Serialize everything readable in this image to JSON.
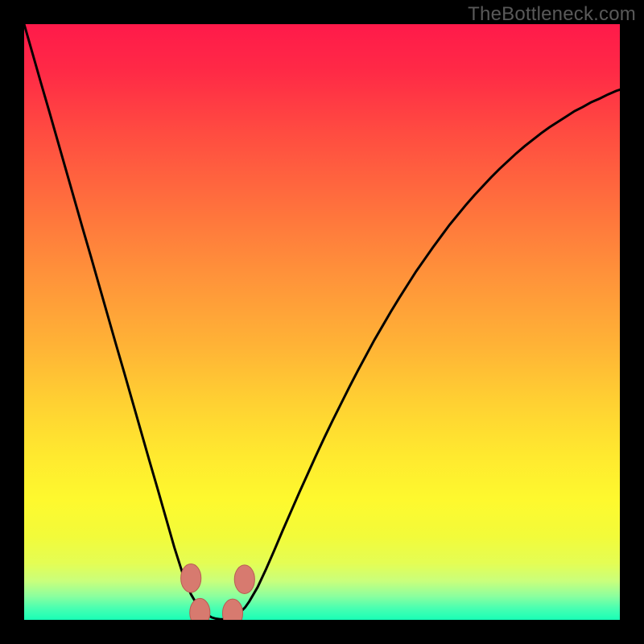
{
  "watermark": {
    "text": "TheBottleneck.com"
  },
  "colors": {
    "black": "#000000",
    "curve": "#000000",
    "dot_fill": "#d77a6f",
    "dot_stroke": "#b85c52",
    "gradient_stops": [
      [
        "0.00",
        "#ff1a4a"
      ],
      [
        "0.08",
        "#ff2a46"
      ],
      [
        "0.18",
        "#ff4b41"
      ],
      [
        "0.30",
        "#ff6f3d"
      ],
      [
        "0.42",
        "#ff923a"
      ],
      [
        "0.54",
        "#ffb336"
      ],
      [
        "0.64",
        "#ffd232"
      ],
      [
        "0.72",
        "#ffe82f"
      ],
      [
        "0.80",
        "#fef92e"
      ],
      [
        "0.86",
        "#f2fb3a"
      ],
      [
        "0.905",
        "#e4fd54"
      ],
      [
        "0.935",
        "#c9ff7c"
      ],
      [
        "0.96",
        "#8cff9e"
      ],
      [
        "0.98",
        "#4affb1"
      ],
      [
        "1.00",
        "#18ffb6"
      ]
    ]
  },
  "chart_data": {
    "type": "line",
    "title": "",
    "xlabel": "",
    "ylabel": "",
    "xlim": [
      0,
      1
    ],
    "ylim": [
      0,
      1
    ],
    "grid": false,
    "legend": false,
    "x": [
      0.0,
      0.014,
      0.028,
      0.042,
      0.056,
      0.07,
      0.084,
      0.098,
      0.112,
      0.126,
      0.14,
      0.154,
      0.168,
      0.182,
      0.196,
      0.21,
      0.224,
      0.238,
      0.252,
      0.266,
      0.28,
      0.287,
      0.294,
      0.301,
      0.308,
      0.315,
      0.322,
      0.329,
      0.336,
      0.343,
      0.35,
      0.357,
      0.364,
      0.371,
      0.378,
      0.392,
      0.406,
      0.42,
      0.434,
      0.448,
      0.462,
      0.476,
      0.49,
      0.504,
      0.518,
      0.532,
      0.546,
      0.56,
      0.574,
      0.588,
      0.602,
      0.616,
      0.63,
      0.644,
      0.658,
      0.672,
      0.686,
      0.7,
      0.714,
      0.728,
      0.742,
      0.756,
      0.77,
      0.784,
      0.798,
      0.812,
      0.826,
      0.84,
      0.854,
      0.868,
      0.882,
      0.896,
      0.91,
      0.924,
      0.938,
      0.952,
      0.966,
      0.98,
      0.994,
      1.0
    ],
    "values": [
      1.0,
      0.951,
      0.902,
      0.854,
      0.805,
      0.756,
      0.707,
      0.658,
      0.61,
      0.561,
      0.512,
      0.463,
      0.415,
      0.366,
      0.317,
      0.268,
      0.22,
      0.171,
      0.122,
      0.078,
      0.043,
      0.031,
      0.021,
      0.014,
      0.008,
      0.004,
      0.002,
      0.001,
      0.001,
      0.002,
      0.004,
      0.008,
      0.014,
      0.021,
      0.031,
      0.055,
      0.085,
      0.117,
      0.15,
      0.182,
      0.214,
      0.245,
      0.276,
      0.306,
      0.335,
      0.363,
      0.391,
      0.418,
      0.444,
      0.47,
      0.494,
      0.518,
      0.541,
      0.563,
      0.585,
      0.605,
      0.625,
      0.644,
      0.663,
      0.68,
      0.697,
      0.713,
      0.728,
      0.743,
      0.757,
      0.77,
      0.783,
      0.795,
      0.806,
      0.817,
      0.827,
      0.836,
      0.845,
      0.854,
      0.861,
      0.869,
      0.875,
      0.882,
      0.888,
      0.89
    ],
    "dots": [
      {
        "x": 0.28,
        "y": 0.07
      },
      {
        "x": 0.295,
        "y": 0.012
      },
      {
        "x": 0.35,
        "y": 0.011
      },
      {
        "x": 0.37,
        "y": 0.068
      }
    ],
    "dot_rx": 0.017,
    "dot_ry": 0.024
  }
}
